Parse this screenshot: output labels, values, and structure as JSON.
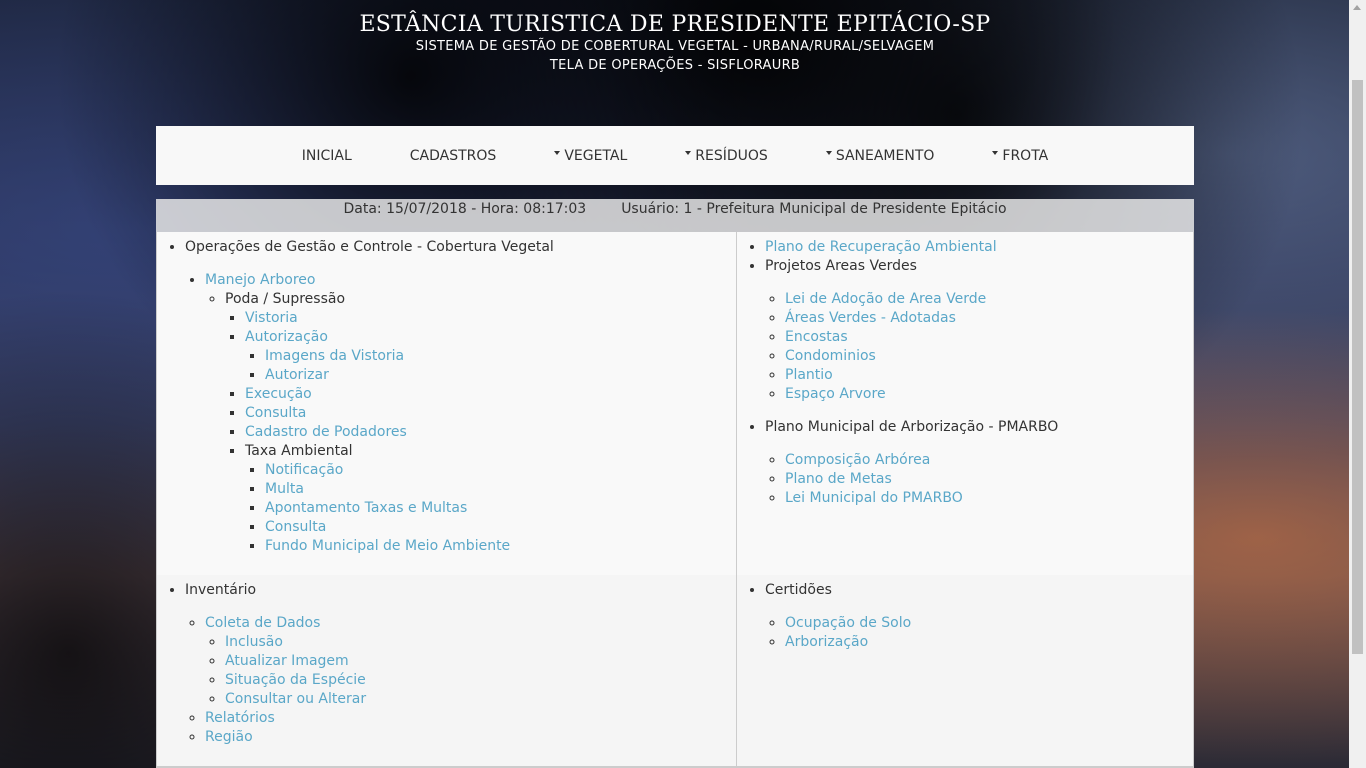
{
  "header": {
    "title": "ESTÂNCIA TURISTICA DE PRESIDENTE EPITÁCIO-SP",
    "subtitle": "SISTEMA DE GESTÃO DE COBERTURAL VEGETAL - URBANA/RURAL/SELVAGEM",
    "screen": "TELA DE OPERAÇÕES - SISFLORAURB"
  },
  "nav": {
    "inicial": "INICIAL",
    "cadastros": "CADASTROS",
    "vegetal": "VEGETAL",
    "residuos": "RESÍDUOS",
    "saneamento": "SANEAMENTO",
    "frota": "FROTA"
  },
  "info": {
    "datetime": "Data: 15/07/2018 - Hora: 08:17:03",
    "user": "Usuário: 1 - Prefeitura Municipal de Presidente Epitácio"
  },
  "panel1": {
    "title": "Operações de Gestão e Controle - Cobertura Vegetal",
    "manejo": "Manejo Arboreo",
    "poda": "Poda / Supressão",
    "vistoria": "Vistoria",
    "autorizacao": "Autorização",
    "imagens": "Imagens da Vistoria",
    "autorizar": "Autorizar",
    "execucao": "Execução",
    "consulta": "Consulta",
    "cadastro_podadores": "Cadastro de Podadores",
    "taxa": "Taxa Ambiental",
    "notificacao": "Notificação",
    "multa": "Multa",
    "apontamento": "Apontamento Taxas e Multas",
    "consulta2": "Consulta",
    "fundo": "Fundo Municipal de Meio Ambiente"
  },
  "panel2": {
    "plano_recuperacao": "Plano de Recuperação Ambiental",
    "projetos": "Projetos Areas Verdes",
    "lei_adocao": "Lei de Adoção de Area Verde",
    "areas_adotadas": "Áreas Verdes - Adotadas",
    "encostas": "Encostas",
    "condominios": "Condominios",
    "plantio": "Plantio",
    "espaco": "Espaço Arvore",
    "pmarbo": "Plano Municipal de Arborização - PMARBO",
    "composicao": "Composição Arbórea",
    "metas": "Plano de Metas",
    "lei_pmarbo": "Lei Municipal do PMARBO"
  },
  "panel3": {
    "inventario": "Inventário",
    "coleta": "Coleta de Dados",
    "inclusao": "Inclusão",
    "atualizar": "Atualizar Imagem",
    "situacao": "Situação da Espécie",
    "consultar": "Consultar ou Alterar",
    "relatorios": "Relatórios",
    "regiao": "Região"
  },
  "panel4": {
    "certidoes": "Certidões",
    "ocupacao": "Ocupação de Solo",
    "arborizacao": "Arborização"
  }
}
